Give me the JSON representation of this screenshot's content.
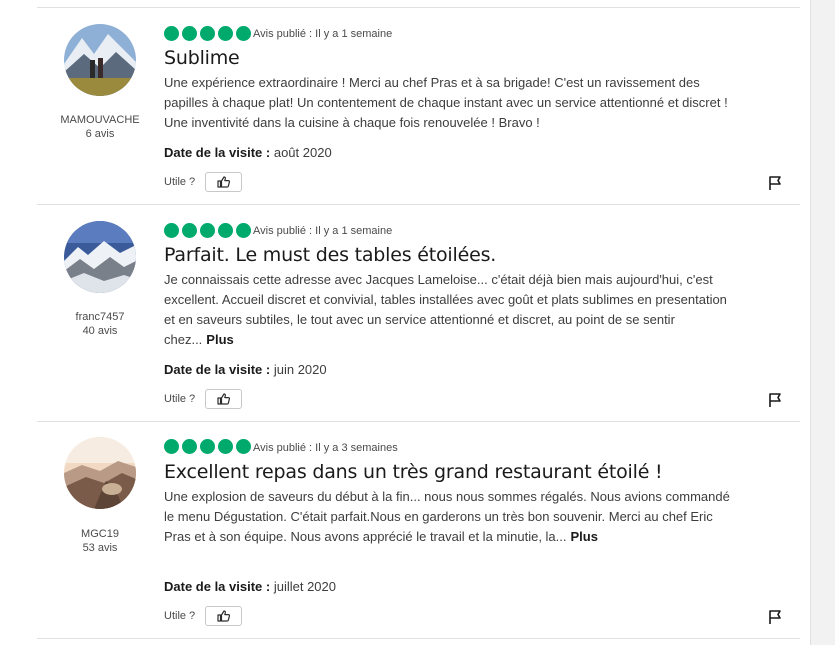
{
  "reviews": [
    {
      "user": "MAMOUVACHE",
      "count": "6 avis",
      "published": "Avis publié : Il y a 1 semaine",
      "title": "Sublime",
      "body": "Une expérience extraordinaire ! Merci au chef Pras et à sa brigade! C'est un ravissement des papilles à chaque plat! Un contentement de chaque instant avec un service attentionné et discret ! Une inventivité dans la cuisine à chaque fois renouvelée ! Bravo !",
      "more": "",
      "visit_label": "Date de la visite :",
      "visit_date": "août 2020",
      "useful": "Utile ?"
    },
    {
      "user": "franc7457",
      "count": "40 avis",
      "published": "Avis publié : Il y a 1 semaine",
      "title": "Parfait. Le must des tables étoilées.",
      "body": "Je connaissais cette adresse avec Jacques Lameloise... c'était déjà bien mais aujourd'hui, c'est excellent. Accueil discret et convivial, tables installées avec goût et plats sublimes en presentation et en saveurs subtiles, le tout avec un service attentionné et discret, au point de se sentir chez...",
      "more": "Plus",
      "visit_label": "Date de la visite :",
      "visit_date": "juin 2020",
      "useful": "Utile ?"
    },
    {
      "user": "MGC19",
      "count": "53 avis",
      "published": "Avis publié : Il y a 3 semaines",
      "title": "Excellent repas dans un très grand restaurant étoilé !",
      "body": "Une explosion de saveurs du début à la fin... nous nous sommes régalés. Nous avions commandé le menu Dégustation. C'était parfait.Nous en garderons un très bon souvenir. Merci au chef Eric Pras et à son équipe. Nous avons apprécié le travail et la minutie, la...",
      "more": "Plus",
      "visit_label": "Date de la visite :",
      "visit_date": "juillet 2020",
      "useful": "Utile ?"
    }
  ],
  "colors": {
    "rating": "#00aa6c",
    "divider": "#e0e0e0"
  },
  "icons": {
    "like": "thumbs-up-icon",
    "report": "flag-icon"
  }
}
